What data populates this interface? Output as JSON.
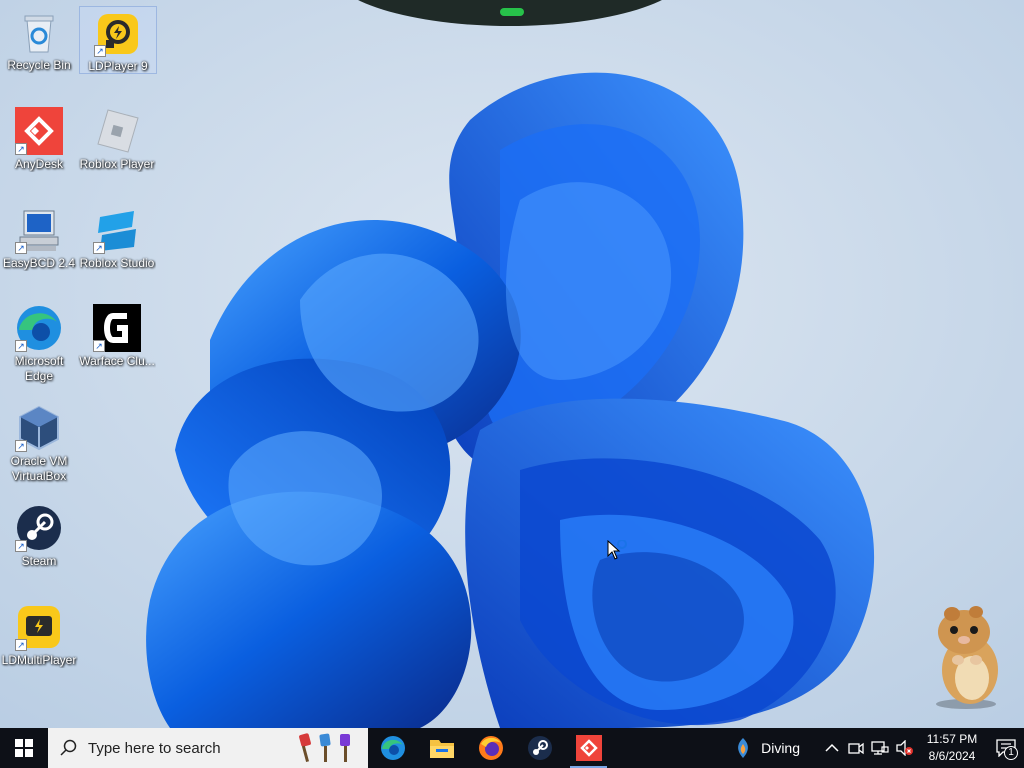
{
  "desktop": {
    "icons": [
      {
        "label": "Recycle Bin",
        "icon": "recycle-bin-icon"
      },
      {
        "label": "LDPlayer 9",
        "icon": "ldplayer-icon"
      },
      {
        "label": "AnyDesk",
        "icon": "anydesk-icon"
      },
      {
        "label": "Roblox Player",
        "icon": "roblox-player-icon"
      },
      {
        "label": "EasyBCD 2.4",
        "icon": "easybcd-icon"
      },
      {
        "label": "Roblox Studio",
        "icon": "roblox-studio-icon"
      },
      {
        "label": "Microsoft\nEdge",
        "icon": "edge-icon"
      },
      {
        "label": "Warface Clu...",
        "icon": "warface-icon"
      },
      {
        "label": "Oracle VM\nVirtualBox",
        "icon": "virtualbox-icon"
      },
      {
        "label": "Steam",
        "icon": "steam-icon"
      },
      {
        "label": "LDMultiPlayer",
        "icon": "ldmultiplayer-icon"
      }
    ]
  },
  "taskbar": {
    "search_placeholder": "Type here to search",
    "pinned": [
      "edge-icon",
      "file-explorer-icon",
      "firefox-icon",
      "steam-icon",
      "anydesk-icon"
    ],
    "weather": {
      "text": "Diving",
      "icon": "weather-diving-icon"
    },
    "clock": {
      "time": "11:57 PM",
      "date": "8/6/2024"
    },
    "notification_count": "1"
  },
  "colors": {
    "taskbar": "#0d1017",
    "accent": "#1a73e8"
  }
}
